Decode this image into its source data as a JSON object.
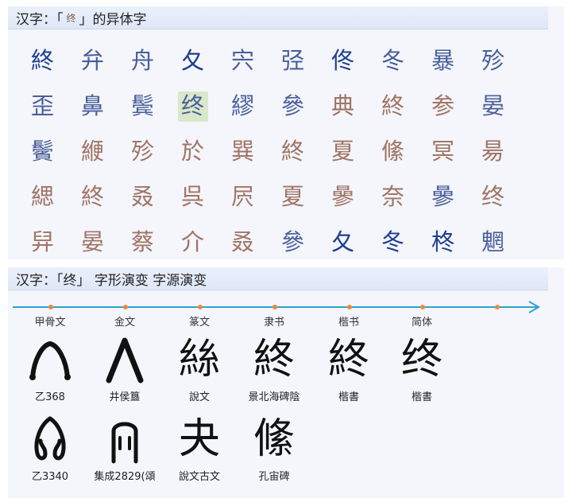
{
  "variants_panel": {
    "title_prefix": "汉字：「",
    "title_glyph": "终",
    "title_suffix": "」的异体字",
    "rows": [
      [
        {
          "c": "終",
          "t": "blue"
        },
        {
          "c": "弁",
          "t": "slate"
        },
        {
          "c": "舟",
          "t": "slate"
        },
        {
          "c": "夂",
          "t": "blue"
        },
        {
          "c": "宍",
          "t": "slate"
        },
        {
          "c": "弪",
          "t": "slate"
        },
        {
          "c": "佟",
          "t": "blue"
        },
        {
          "c": "冬",
          "t": "slate"
        },
        {
          "c": "暴",
          "t": "slate"
        },
        {
          "c": "殄",
          "t": "slate"
        }
      ],
      [
        {
          "c": "歪",
          "t": "slate"
        },
        {
          "c": "鼻",
          "t": "slate"
        },
        {
          "c": "鬓",
          "t": "slate"
        },
        {
          "c": "终",
          "t": "slate",
          "sel": true
        },
        {
          "c": "繆",
          "t": "slate"
        },
        {
          "c": "參",
          "t": "slate"
        },
        {
          "c": "典",
          "t": "brown"
        },
        {
          "c": "終",
          "t": "brown"
        },
        {
          "c": "参",
          "t": "brown"
        },
        {
          "c": "晏",
          "t": "slate"
        }
      ],
      [
        {
          "c": "鬢",
          "t": "slate"
        },
        {
          "c": "緶",
          "t": "brown"
        },
        {
          "c": "殄",
          "t": "brown"
        },
        {
          "c": "於",
          "t": "brown"
        },
        {
          "c": "巽",
          "t": "brown"
        },
        {
          "c": "終",
          "t": "brown"
        },
        {
          "c": "夏",
          "t": "brown"
        },
        {
          "c": "絛",
          "t": "brown"
        },
        {
          "c": "冥",
          "t": "brown"
        },
        {
          "c": "昜",
          "t": "brown"
        }
      ],
      [
        {
          "c": "緦",
          "t": "brown"
        },
        {
          "c": "終",
          "t": "brown"
        },
        {
          "c": "叒",
          "t": "brown"
        },
        {
          "c": "呉",
          "t": "brown"
        },
        {
          "c": "屄",
          "t": "brown"
        },
        {
          "c": "夏",
          "t": "brown"
        },
        {
          "c": "曑",
          "t": "brown"
        },
        {
          "c": "奈",
          "t": "brown"
        },
        {
          "c": "曑",
          "t": "slate"
        },
        {
          "c": "终",
          "t": "brown"
        }
      ],
      [
        {
          "c": "舁",
          "t": "brown"
        },
        {
          "c": "晏",
          "t": "brown"
        },
        {
          "c": "蔡",
          "t": "brown"
        },
        {
          "c": "介",
          "t": "brown"
        },
        {
          "c": "叒",
          "t": "brown"
        },
        {
          "c": "參",
          "t": "slate"
        },
        {
          "c": "夂",
          "t": "blue"
        },
        {
          "c": "冬",
          "t": "blue"
        },
        {
          "c": "柊",
          "t": "blue"
        },
        {
          "c": "魍",
          "t": "slate"
        }
      ]
    ]
  },
  "evolution_panel": {
    "title": "汉字：「终」 字形演变 字源演变",
    "stages": [
      "甲骨文",
      "金文",
      "篆文",
      "隶书",
      "楷书",
      "简体"
    ],
    "row1": [
      {
        "glyph": "∧",
        "caption": "乙368"
      },
      {
        "glyph": "∧",
        "caption": "井侯簋"
      },
      {
        "glyph": "絲",
        "caption": "說文"
      },
      {
        "glyph": "終",
        "caption": "景北海碑陰"
      },
      {
        "glyph": "終",
        "caption": "楷書"
      },
      {
        "glyph": "终",
        "caption": "楷書"
      }
    ],
    "row2": [
      {
        "glyph": "∩",
        "caption": "乙3340"
      },
      {
        "glyph": "∩",
        "caption": "集成2829(頌"
      },
      {
        "glyph": "夬",
        "caption": "說文古文"
      },
      {
        "glyph": "絛",
        "caption": "孔宙碑"
      }
    ]
  },
  "colors": {
    "accent_timeline": "#2aa3d8",
    "timeline_dot": "#f0883a",
    "selected_bg": "#d9e8c8"
  }
}
